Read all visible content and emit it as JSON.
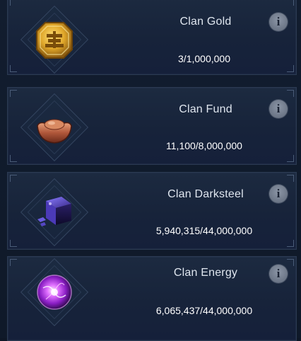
{
  "resources": [
    {
      "name": "Clan Gold",
      "value": "3/1,000,000",
      "icon": "clan-gold-coin-icon"
    },
    {
      "name": "Clan Fund",
      "value": "11,100/8,000,000",
      "icon": "clan-fund-ingot-icon"
    },
    {
      "name": "Clan Darksteel",
      "value": "5,940,315/44,000,000",
      "icon": "clan-darksteel-cube-icon"
    },
    {
      "name": "Clan Energy",
      "value": "6,065,437/44,000,000",
      "icon": "clan-energy-orb-icon"
    }
  ],
  "info_icon_glyph": "i",
  "colors": {
    "card_border": "#2b3a52",
    "title_text": "#dfe6ef",
    "value_text": "#ffffff",
    "info_button": "#7a8494"
  }
}
